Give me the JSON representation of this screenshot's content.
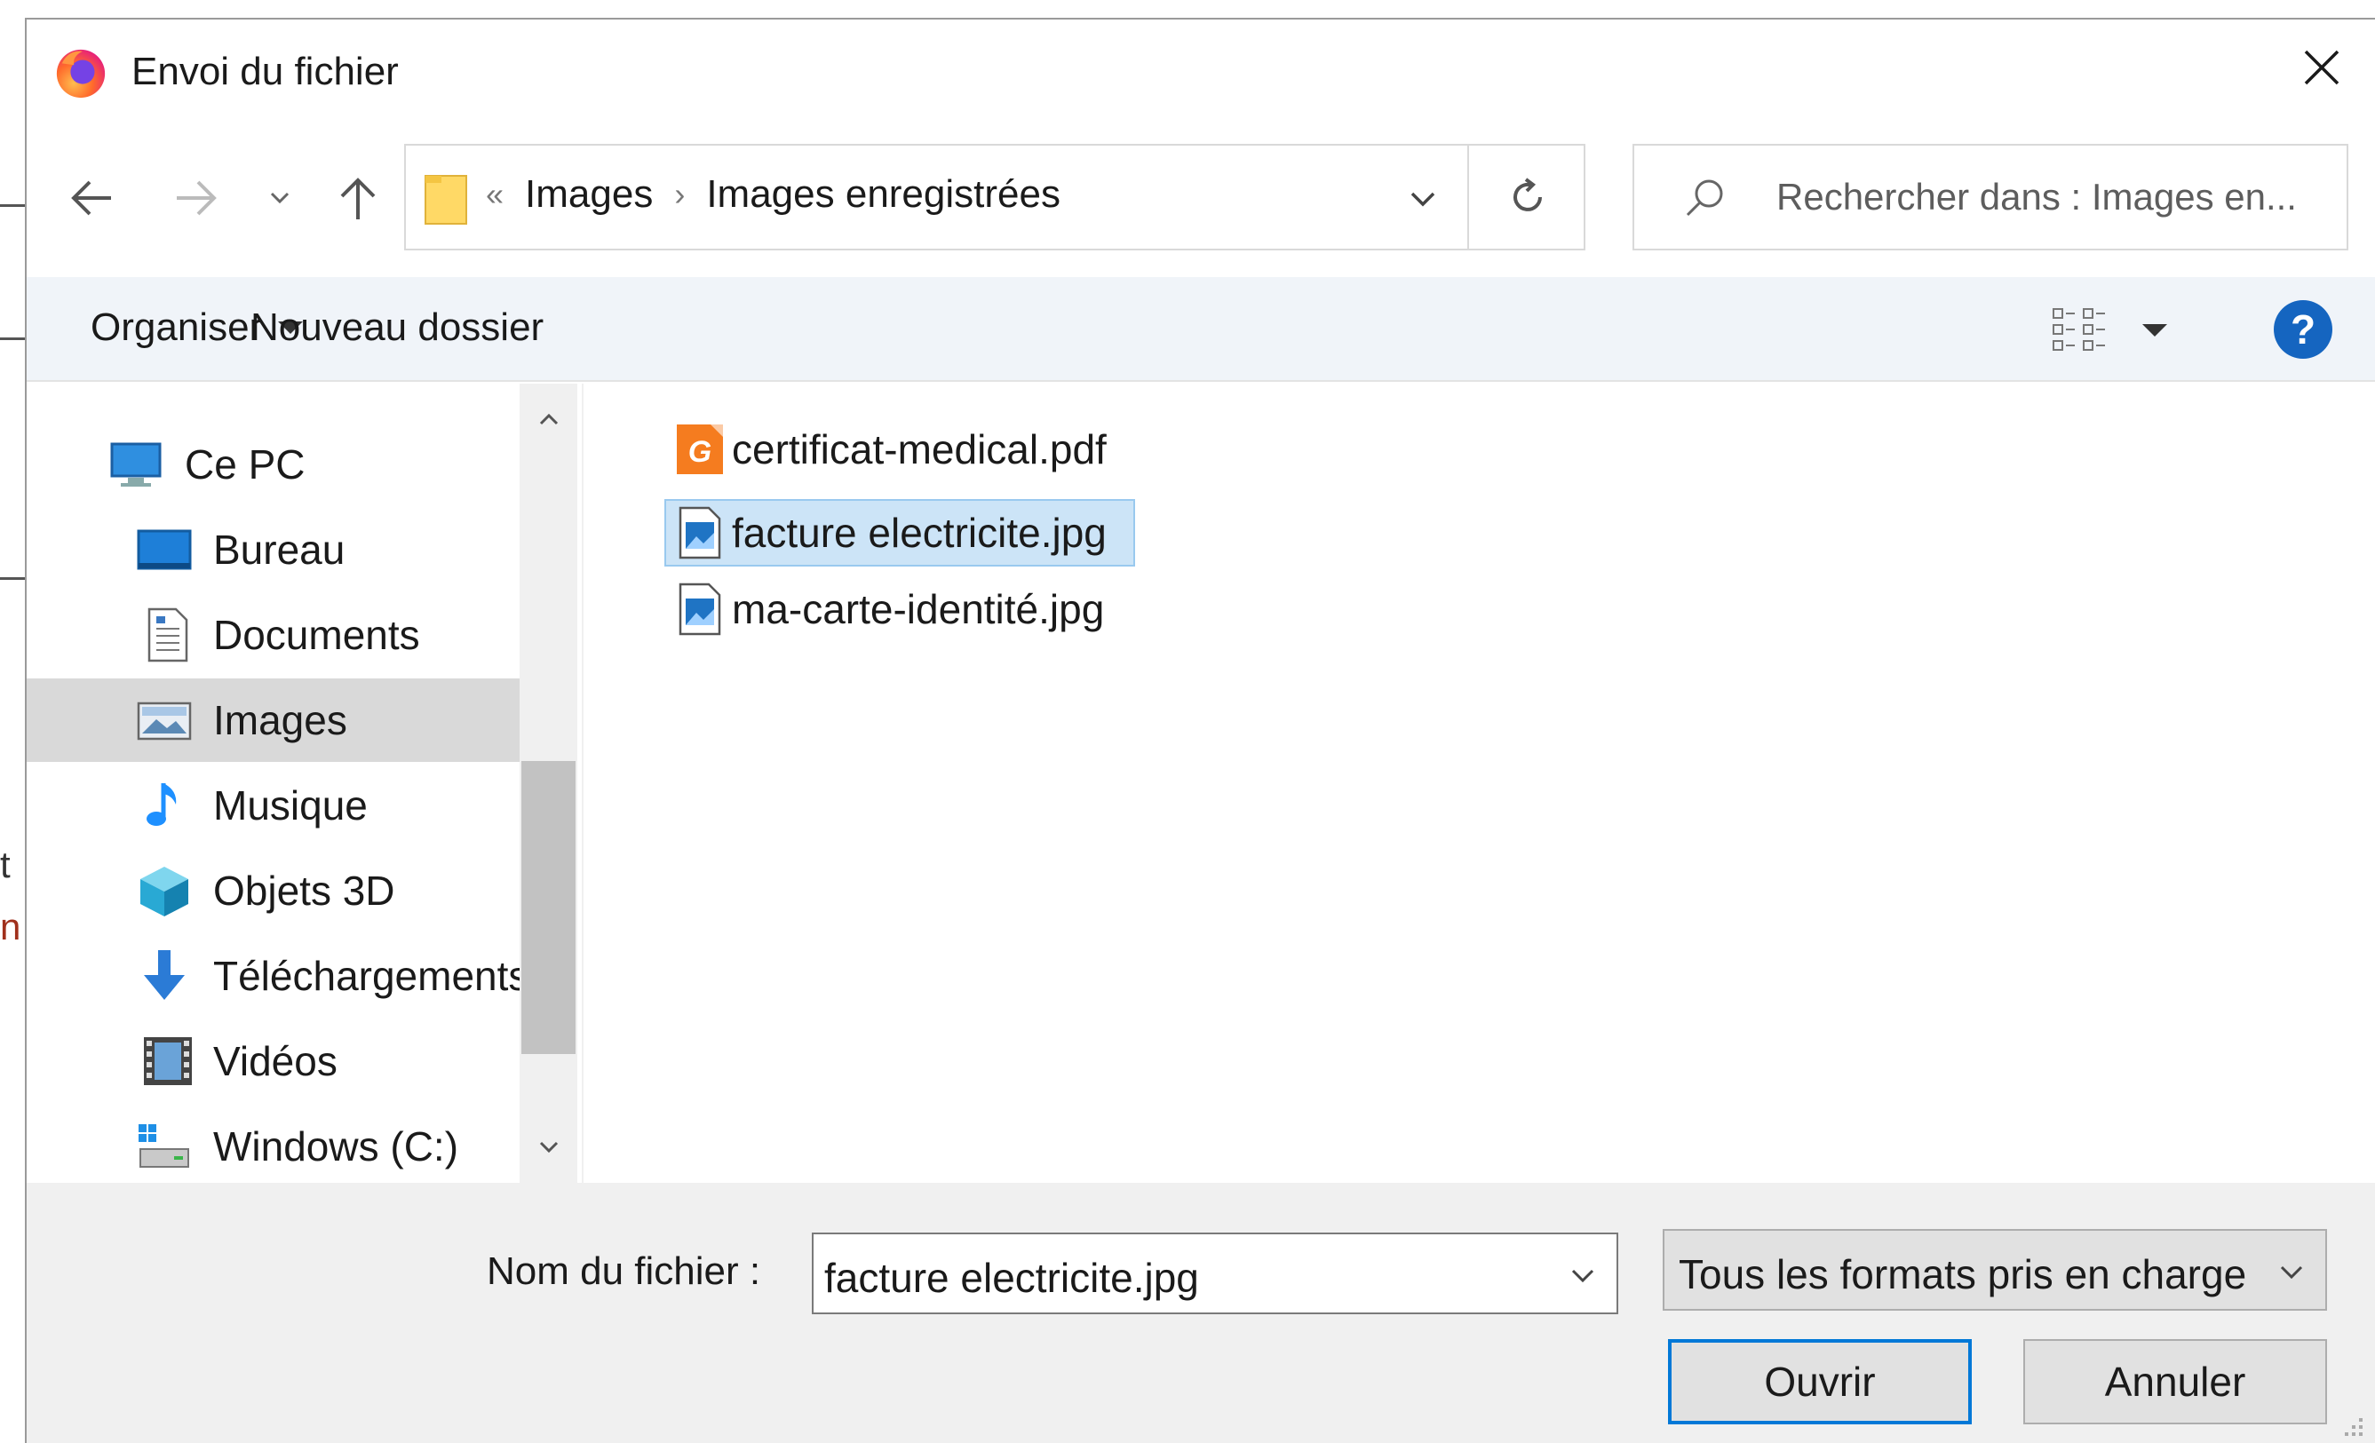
{
  "background_fragments": {
    "text1": "t",
    "text2": "n"
  },
  "dialog": {
    "title": "Envoi du fichier"
  },
  "nav": {
    "back_icon": "arrow-left-icon",
    "forward_icon": "arrow-right-icon",
    "recent_icon": "chevron-down-icon",
    "up_icon": "arrow-up-icon"
  },
  "address": {
    "overflow": "«",
    "crumbs": [
      "Images",
      "Images enregistrées"
    ]
  },
  "search": {
    "placeholder": "Rechercher dans : Images en..."
  },
  "toolbar": {
    "organize_label": "Organiser",
    "new_folder_label": "Nouveau dossier",
    "help_label": "?"
  },
  "sidebar": {
    "items": [
      {
        "label": "Ce PC",
        "icon": "computer-icon"
      },
      {
        "label": "Bureau",
        "icon": "desktop-icon"
      },
      {
        "label": "Documents",
        "icon": "document-icon"
      },
      {
        "label": "Images",
        "icon": "pictures-icon",
        "selected": true
      },
      {
        "label": "Musique",
        "icon": "music-icon"
      },
      {
        "label": "Objets 3D",
        "icon": "cube-icon"
      },
      {
        "label": "Téléchargements",
        "icon": "download-icon"
      },
      {
        "label": "Vidéos",
        "icon": "video-icon"
      },
      {
        "label": "Windows (C:)",
        "icon": "drive-icon"
      }
    ]
  },
  "files": [
    {
      "name": "certificat-medical.pdf",
      "icon": "pdf-icon"
    },
    {
      "name": "facture electricite.jpg",
      "icon": "image-file-icon",
      "selected": true
    },
    {
      "name": "ma-carte-identité.jpg",
      "icon": "image-file-icon"
    }
  ],
  "footer": {
    "filename_label": "Nom du fichier :",
    "filename_value": "facture electricite.jpg",
    "filter_value": "Tous les formats pris en charge",
    "open_label": "Ouvrir",
    "cancel_label": "Annuler"
  },
  "colors": {
    "accent": "#0078d7",
    "selection": "#cce4f7",
    "help": "#1565c0"
  }
}
